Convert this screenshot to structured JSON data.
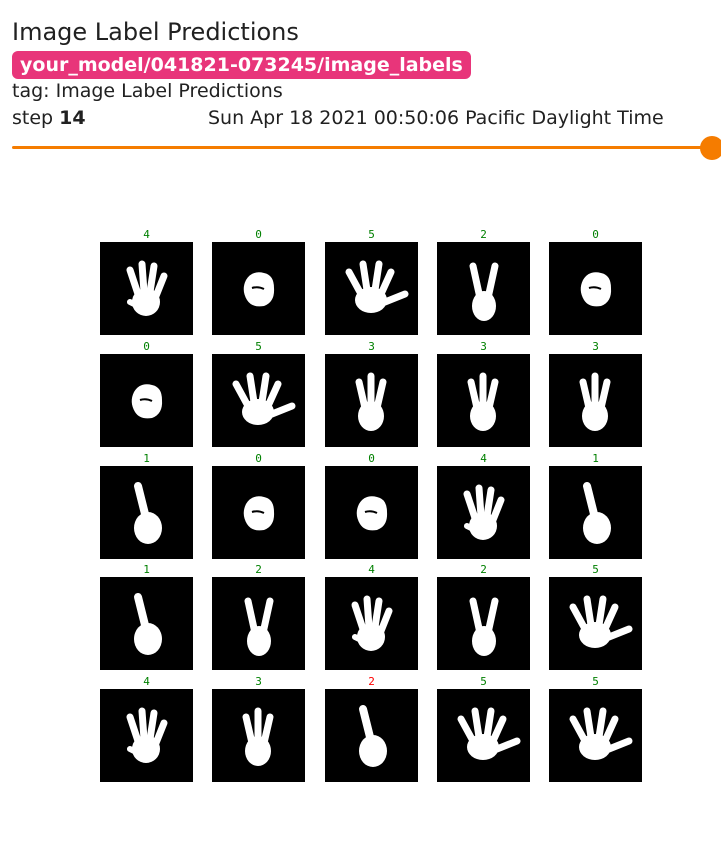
{
  "card": {
    "title": "Image Label Predictions",
    "run": "your_model/041821-073245/image_labels",
    "tag_line": "tag: Image Label Predictions",
    "step_label": "step",
    "step_value": "14",
    "timestamp": "Sun Apr 18 2021 00:50:06 Pacific Daylight Time",
    "slider_position": 1.0
  },
  "colors": {
    "run_badge": "#e8357a",
    "slider": "#f57c00",
    "label_correct": "#008000",
    "label_wrong": "#ff0000",
    "image_bg": "#000000",
    "hand": "#ffffff"
  },
  "grid": {
    "rows": 5,
    "cols": 5,
    "cells": [
      {
        "label": "4",
        "correct": true,
        "icon": "hand-four-fingers-icon"
      },
      {
        "label": "0",
        "correct": true,
        "icon": "hand-fist-icon"
      },
      {
        "label": "5",
        "correct": true,
        "icon": "hand-open-icon"
      },
      {
        "label": "2",
        "correct": true,
        "icon": "hand-two-fingers-icon"
      },
      {
        "label": "0",
        "correct": true,
        "icon": "hand-fist-icon"
      },
      {
        "label": "0",
        "correct": true,
        "icon": "hand-fist-icon"
      },
      {
        "label": "5",
        "correct": true,
        "icon": "hand-open-icon"
      },
      {
        "label": "3",
        "correct": true,
        "icon": "hand-three-fingers-icon"
      },
      {
        "label": "3",
        "correct": true,
        "icon": "hand-three-fingers-icon"
      },
      {
        "label": "3",
        "correct": true,
        "icon": "hand-three-fingers-icon"
      },
      {
        "label": "1",
        "correct": true,
        "icon": "hand-one-finger-icon"
      },
      {
        "label": "0",
        "correct": true,
        "icon": "hand-fist-icon"
      },
      {
        "label": "0",
        "correct": true,
        "icon": "hand-fist-icon"
      },
      {
        "label": "4",
        "correct": true,
        "icon": "hand-four-fingers-icon"
      },
      {
        "label": "1",
        "correct": true,
        "icon": "hand-one-finger-icon"
      },
      {
        "label": "1",
        "correct": true,
        "icon": "hand-one-finger-icon"
      },
      {
        "label": "2",
        "correct": true,
        "icon": "hand-two-fingers-icon"
      },
      {
        "label": "4",
        "correct": true,
        "icon": "hand-four-fingers-icon"
      },
      {
        "label": "2",
        "correct": true,
        "icon": "hand-two-fingers-icon"
      },
      {
        "label": "5",
        "correct": true,
        "icon": "hand-open-icon"
      },
      {
        "label": "4",
        "correct": true,
        "icon": "hand-four-fingers-icon"
      },
      {
        "label": "3",
        "correct": true,
        "icon": "hand-three-fingers-icon"
      },
      {
        "label": "2",
        "correct": false,
        "icon": "hand-one-finger-icon"
      },
      {
        "label": "5",
        "correct": true,
        "icon": "hand-open-icon"
      },
      {
        "label": "5",
        "correct": true,
        "icon": "hand-open-icon"
      }
    ]
  }
}
